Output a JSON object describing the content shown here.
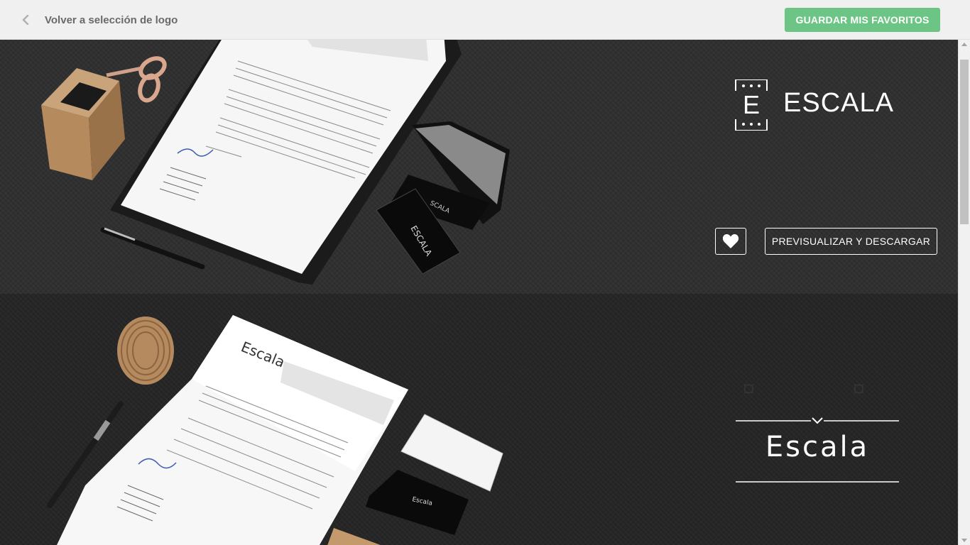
{
  "topbar": {
    "back_icon": "chevron-left-icon",
    "back_label": "Volver a selección de logo",
    "save_label": "GUARDAR MIS FAVORITOS",
    "accent": "#6cc585"
  },
  "cards": [
    {
      "brand": "ESCALA",
      "mark_letter": "E",
      "favorite_icon": "heart-icon",
      "preview_label": "PREVISUALIZAR Y DESCARGAR"
    },
    {
      "brand": "Escala"
    }
  ]
}
